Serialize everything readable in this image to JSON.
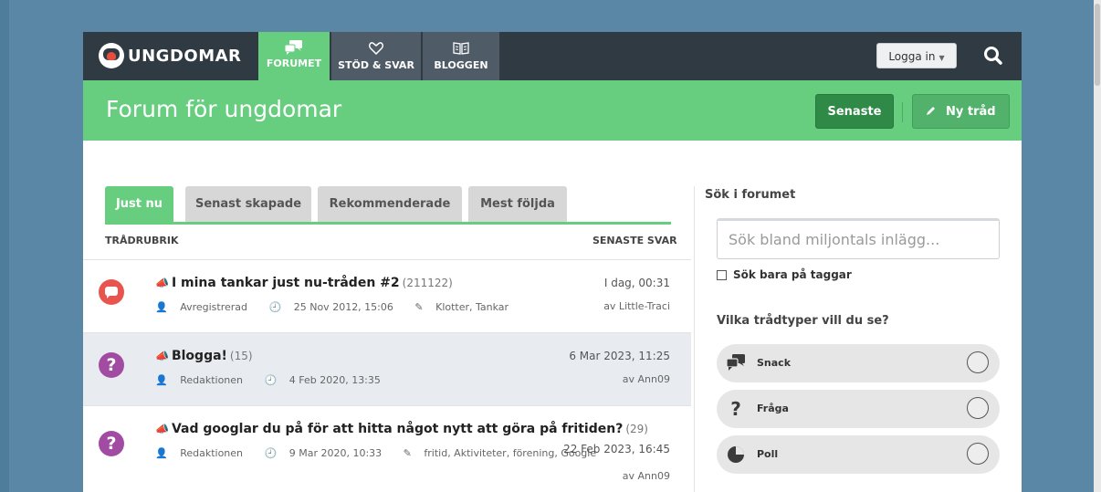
{
  "brand": {
    "name": "UNGDOMAR"
  },
  "nav": {
    "tabs": [
      {
        "label": "FORUMET",
        "icon": "chat-bubbles-icon"
      },
      {
        "label": "STÖD & SVAR",
        "icon": "heart-icon"
      },
      {
        "label": "BLOGGEN",
        "icon": "book-icon"
      }
    ],
    "login_label": "Logga in",
    "search_icon": "search-icon"
  },
  "header": {
    "title": "Forum för ungdomar",
    "latest_label": "Senaste",
    "new_thread_label": "Ny tråd"
  },
  "tabs": [
    {
      "label": "Just nu",
      "active": true
    },
    {
      "label": "Senast skapade",
      "active": false
    },
    {
      "label": "Rekommenderade",
      "active": false
    },
    {
      "label": "Mest följda",
      "active": false
    }
  ],
  "columns": {
    "topic": "TRÅDRUBRIK",
    "latest_reply": "SENASTE SVAR"
  },
  "threads": [
    {
      "title": "I mina tankar just nu-tråden #2",
      "count": "(211122)",
      "type": "snack",
      "author": "Avregistrerad",
      "created": "25 Nov 2012, 15:06",
      "tags": "Klotter, Tankar",
      "last_date": "I dag, 00:31",
      "last_by": "av Little-Traci"
    },
    {
      "title": "Blogga!",
      "count": "(15)",
      "type": "fraga",
      "author": "Redaktionen",
      "created": "4 Feb 2020, 13:35",
      "tags": "",
      "last_date": "6 Mar 2023, 11:25",
      "last_by": "av Ann09"
    },
    {
      "title": "Vad googlar du på för att hitta något nytt att göra på fritiden?",
      "count": "(29)",
      "type": "fraga",
      "author": "Redaktionen",
      "created": "9 Mar 2020, 10:33",
      "tags": "fritid, Aktiviteter, förening, Google",
      "last_date": "22 Feb 2023, 16:45",
      "last_by": "av Ann09"
    }
  ],
  "sidebar": {
    "search_heading": "Sök i forumet",
    "search_placeholder": "Sök bland miljontals inlägg...",
    "tags_only_label": "Sök bara på taggar",
    "types_heading": "Vilka trådtyper vill du se?",
    "types": [
      {
        "label": "Snack",
        "icon": "chat-bubbles-icon"
      },
      {
        "label": "Fråga",
        "icon": "question-icon"
      },
      {
        "label": "Poll",
        "icon": "pie-chart-icon"
      }
    ]
  },
  "colors": {
    "green": "#67cd7f",
    "dark_green": "#2f8a47",
    "navbar": "#2f3a43",
    "snack_red": "#e8554e",
    "question_purple": "#a14ca2"
  }
}
